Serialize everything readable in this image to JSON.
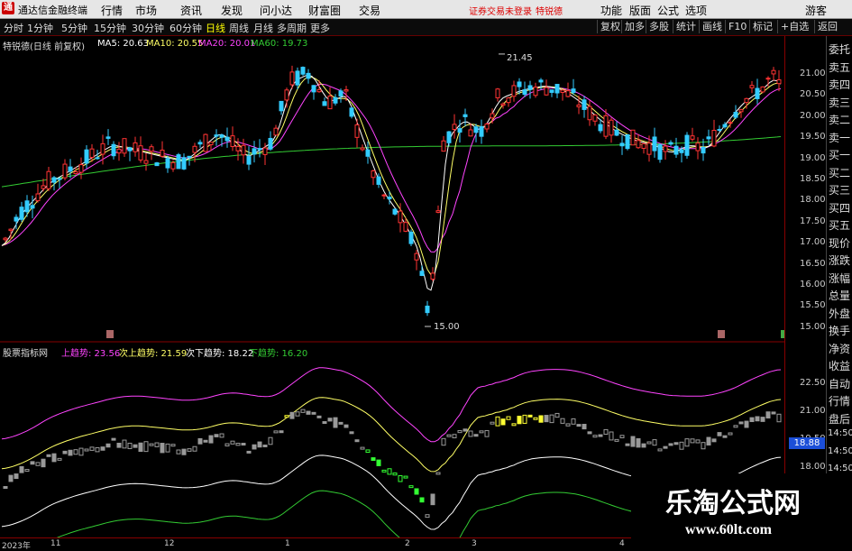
{
  "app": {
    "title": "通达信金融终端",
    "menus": [
      "行情",
      "市场",
      "资讯",
      "发现",
      "问小达",
      "财富圈",
      "交易"
    ],
    "notice": "证券交易未登录",
    "stock_short": "特锐德",
    "right_menus": [
      "功能",
      "版面",
      "公式",
      "选项",
      "游客"
    ]
  },
  "toolbar": {
    "timeframes": [
      "分时",
      "1分钟",
      "5分钟",
      "15分钟",
      "30分钟",
      "60分钟",
      "日线",
      "周线",
      "月线",
      "多周期",
      "更多"
    ],
    "selected": "日线",
    "right_buttons": [
      "复权",
      "加多",
      "多股",
      "统计",
      "画线",
      "F10",
      "标记",
      "+自选",
      "返回"
    ]
  },
  "main_chart": {
    "title": "特锐德(日线 前复权)",
    "ma_legend": [
      {
        "label": "MA5: 20.63",
        "color": "#ffffff"
      },
      {
        "label": "MA10: 20.55",
        "color": "#ffff66"
      },
      {
        "label": "MA20: 20.01",
        "color": "#ff44ff"
      },
      {
        "label": "MA60: 19.73",
        "color": "#33cc33"
      }
    ],
    "y_ticks": [
      "21.00",
      "20.50",
      "20.00",
      "19.50",
      "19.00",
      "18.50",
      "18.00",
      "17.50",
      "17.00",
      "16.50",
      "16.00",
      "15.50",
      "15.00"
    ],
    "high_label": "21.45",
    "low_label": "15.00"
  },
  "indicator_chart": {
    "title": "股票指标网",
    "legend": [
      {
        "label": "上趋势: 23.56",
        "color": "#ff44ff"
      },
      {
        "label": "次上趋势: 21.59",
        "color": "#ffff66"
      },
      {
        "label": "次下趋势: 18.22",
        "color": "#ffffff"
      },
      {
        "label": "下趋势: 16.20",
        "color": "#33cc33"
      }
    ],
    "y_ticks": [
      "22.50",
      "21.00",
      "19.50",
      "18.00"
    ],
    "current_value": "18.88"
  },
  "side_panel": {
    "items": [
      "委托",
      "卖五",
      "卖四",
      "卖三",
      "卖二",
      "卖一",
      "买一",
      "买二",
      "买三",
      "买四",
      "买五",
      "现价",
      "涨跌",
      "涨幅",
      "总量",
      "外盘",
      "换手",
      "净资",
      "收益",
      "自动",
      "行情",
      "盘后",
      "14:50",
      "14:50",
      "14:50",
      "14:50",
      "14:50",
      "14:50"
    ]
  },
  "bottom_axis": {
    "labels": [
      "2023年",
      "11",
      "12",
      "1",
      "2",
      "3",
      "4"
    ]
  },
  "watermark": {
    "line1": "乐淘公式网",
    "line2": "www.60lt.com"
  },
  "colors": {
    "up": "#ff3333",
    "down": "#33ccff",
    "ma5": "#ffffff",
    "ma10": "#ffff66",
    "ma20": "#ff44ff",
    "ma60": "#33cc33"
  }
}
